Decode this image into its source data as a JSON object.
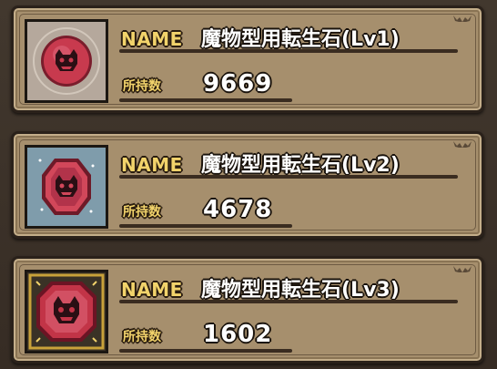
{
  "items": [
    {
      "name_label": "NAME",
      "name": "魔物型用転生石(Lv1)",
      "count_label": "所持数",
      "count": "9669",
      "icon": "round-red-monster-stone-icon",
      "frame_color": "#b9aca0",
      "gem_color": "#c83a4e"
    },
    {
      "name_label": "NAME",
      "name": "魔物型用転生石(Lv2)",
      "count_label": "所持数",
      "count": "4678",
      "icon": "hexagon-red-monster-stone-icon",
      "frame_color": "#7f9cab",
      "gem_color": "#d2475a"
    },
    {
      "name_label": "NAME",
      "name": "魔物型用転生石(Lv3)",
      "count_label": "所持数",
      "count": "1602",
      "icon": "octagon-red-monster-stone-icon",
      "frame_color": "#3a3226",
      "gem_color": "#c23447"
    }
  ]
}
